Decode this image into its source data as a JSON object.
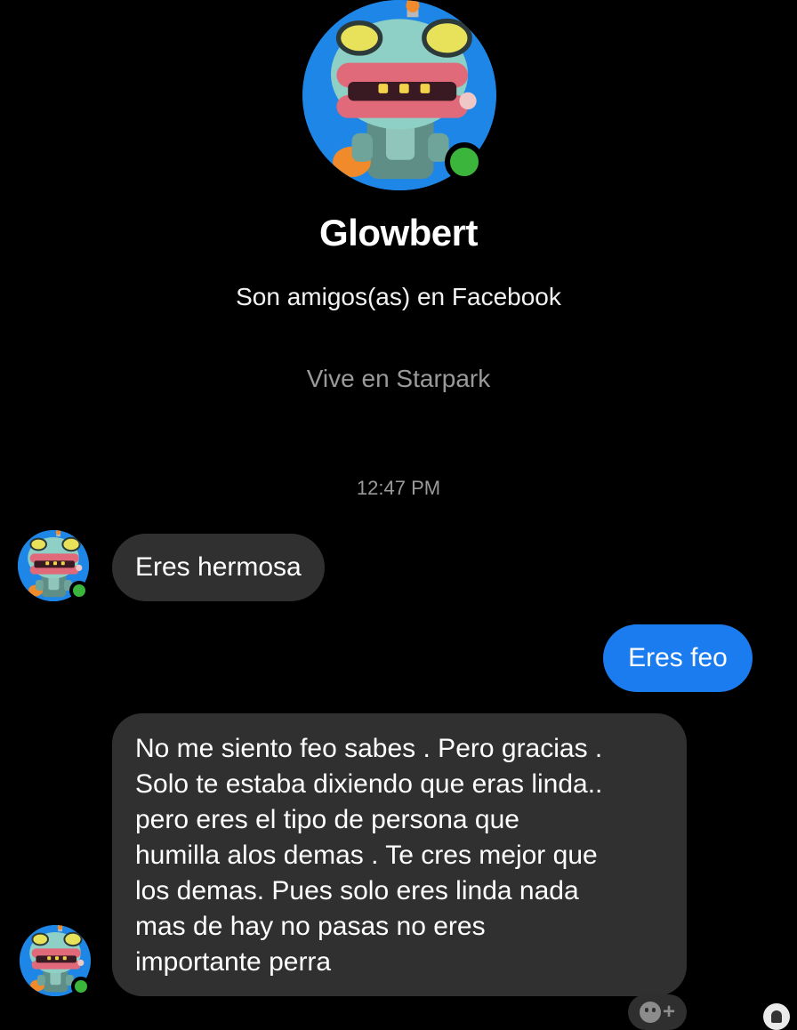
{
  "header": {
    "name": "Glowbert",
    "friend_status": "Son amigos(as) en Facebook",
    "location": "Vive en Starpark"
  },
  "conversation": {
    "timestamp": "12:47 PM",
    "messages": [
      {
        "direction": "incoming",
        "text": "Eres hermosa"
      },
      {
        "direction": "outgoing",
        "text": "Eres feo"
      },
      {
        "direction": "incoming",
        "text": "No me siento feo sabes . Pero gracias .\nSolo te estaba dixiendo que eras linda..\npero eres el tipo de persona que\nhumilla alos demas . Te cres mejor que\nlos demas. Pues solo eres linda nada\nmas de hay no pasas no eres\nimportante perra"
      }
    ]
  },
  "icons": {
    "avatar": "robot-character-avatar-icon",
    "online": "online-status-icon",
    "react": "add-reaction-icon",
    "seen": "seen-by-avatar-icon"
  },
  "colors": {
    "background": "#000000",
    "incoming_bubble": "#303030",
    "outgoing_bubble": "#1b7cf0",
    "online": "#3bb53b",
    "secondary_text": "#9a9a9a"
  }
}
